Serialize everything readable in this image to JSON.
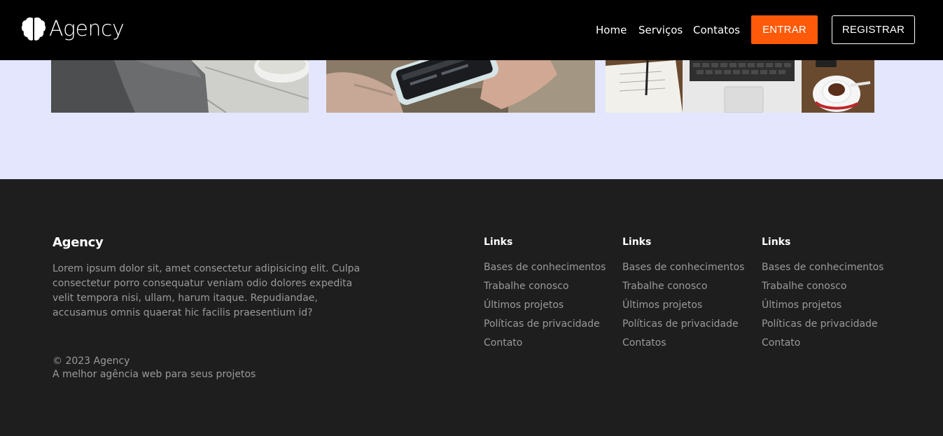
{
  "header": {
    "logo_text": "Agency",
    "logo_icon": "brain-icon",
    "nav": [
      "Home",
      "Serviços",
      "Contatos"
    ],
    "login_label": "ENTRAR",
    "register_label": "REGISTRAR",
    "accent_color": "#ff5a0a"
  },
  "section": {
    "background": "#e4e6fd",
    "images": [
      "blog-photo-socks-coffee",
      "blog-photo-smartphone",
      "blog-photo-laptop-desk"
    ]
  },
  "footer": {
    "brand": "Agency",
    "description": "Lorem ipsum dolor sit, amet consectetur adipisicing elit. Culpa consectetur porro consequatur veniam odio dolores expedita velit tempora nisi, ullam, harum itaque. Repudiandae, accusamus omnis quaerat hic facilis praesentium id?",
    "copyright": "© 2023 Agency",
    "tagline": "A melhor agência web para seus projetos",
    "columns": [
      {
        "title": "Links",
        "links": [
          "Bases de conhecimentos",
          "Trabalhe conosco",
          "Últimos projetos",
          "Políticas de privacidade",
          "Contato"
        ]
      },
      {
        "title": "Links",
        "links": [
          "Bases de conhecimentos",
          "Trabalhe conosco",
          "Últimos projetos",
          "Políticas de privacidade",
          "Contatos"
        ]
      },
      {
        "title": "Links",
        "links": [
          "Bases de conhecimentos",
          "Trabalhe conosco",
          "Últimos projetos",
          "Políticas de privacidade",
          "Contato"
        ]
      }
    ]
  }
}
